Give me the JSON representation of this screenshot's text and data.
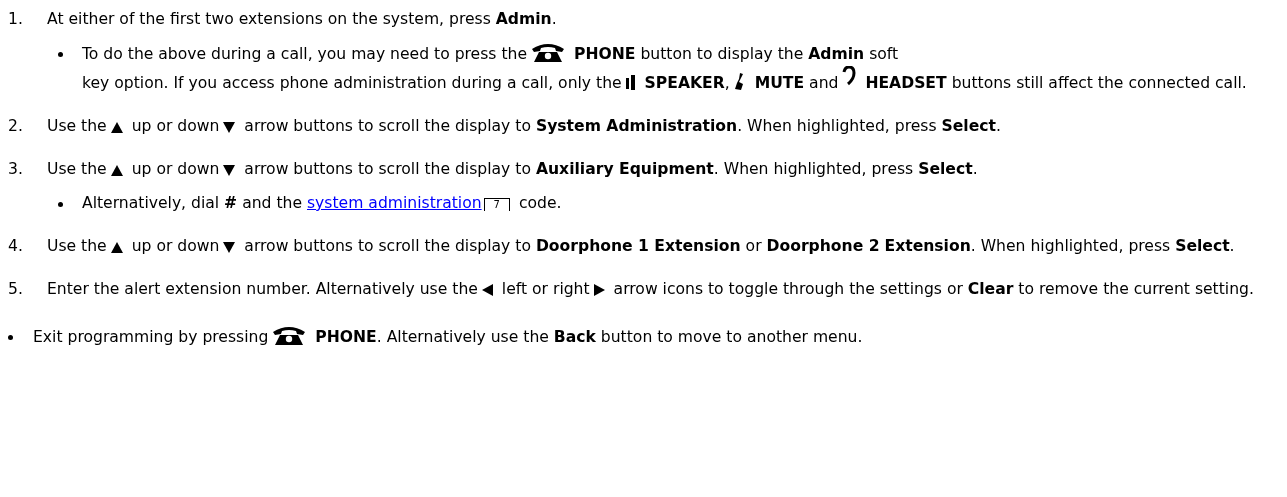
{
  "steps": [
    {
      "number": "1.",
      "parts": [
        {
          "kind": "text",
          "text": "At either of the first two extensions on the system, press **Admin**."
        }
      ],
      "notes": [
        {
          "parts": [
            {
              "kind": "text",
              "text": "To do the above during a call, you may need to press the"
            },
            {
              "kind": "phone"
            },
            {
              "kind": "text",
              "text": "**PHONE** button to display the **Admin** soft"
            },
            {
              "kind": "text",
              "text": "key option. If you access phone administration during a call, only the"
            },
            {
              "kind": "speaker"
            },
            {
              "kind": "text",
              "text": "**SPEAKER**,"
            },
            {
              "kind": "mute"
            },
            {
              "kind": "text",
              "text": "**MUTE** and"
            },
            {
              "kind": "headset"
            },
            {
              "kind": "text",
              "text": "**HEADSET** buttons still affect the connected call."
            }
          ]
        }
      ]
    },
    {
      "number": "2.",
      "parts": [
        {
          "kind": "text",
          "text": "Use the"
        },
        {
          "kind": "up"
        },
        {
          "kind": "text",
          "text": "up or down"
        },
        {
          "kind": "down"
        },
        {
          "kind": "text",
          "text": "arrow buttons to scroll the display to **System Administration**. When highlighted,"
        },
        {
          "kind": "text",
          "text": "press **Select**."
        }
      ]
    },
    {
      "number": "3.",
      "parts": [
        {
          "kind": "text",
          "text": "Use the"
        },
        {
          "kind": "up"
        },
        {
          "kind": "text",
          "text": "up or down"
        },
        {
          "kind": "down"
        },
        {
          "kind": "text",
          "text": "arrow buttons to scroll the display to **Auxiliary Equipment**. When highlighted,"
        },
        {
          "kind": "text",
          "text": "press **Select**."
        }
      ],
      "notes": [
        {
          "parts": [
            {
              "kind": "text",
              "text": "Alternatively, dial **#** and the"
            },
            {
              "kind": "link",
              "text": "system administration"
            },
            {
              "kind": "pageref",
              "text": "7"
            },
            {
              "kind": "text",
              "text": "code."
            }
          ]
        }
      ]
    },
    {
      "number": "4.",
      "parts": [
        {
          "kind": "text",
          "text": "Use the"
        },
        {
          "kind": "up"
        },
        {
          "kind": "text",
          "text": "up or down"
        },
        {
          "kind": "down"
        },
        {
          "kind": "text",
          "text": "arrow buttons to scroll the display to **Doorphone 1 Extension** or **Doorphone 2**"
        },
        {
          "kind": "text",
          "text": "**Extension**. When highlighted, press **Select**."
        }
      ]
    },
    {
      "number": "5.",
      "parts": [
        {
          "kind": "text",
          "text": "Enter the alert extension number. Alternatively use the"
        },
        {
          "kind": "left"
        },
        {
          "kind": "text",
          "text": "left or right"
        },
        {
          "kind": "right"
        },
        {
          "kind": "text",
          "text": "arrow icons to toggle through the"
        },
        {
          "kind": "text",
          "text": "settings or **Clear** to remove the current setting."
        }
      ]
    }
  ],
  "final": [
    {
      "parts": [
        {
          "kind": "text",
          "text": "Exit programming by pressing"
        },
        {
          "kind": "phone"
        },
        {
          "kind": "text",
          "text": "**PHONE**. Alternatively use the **Back** button to move to another menu."
        }
      ]
    }
  ]
}
